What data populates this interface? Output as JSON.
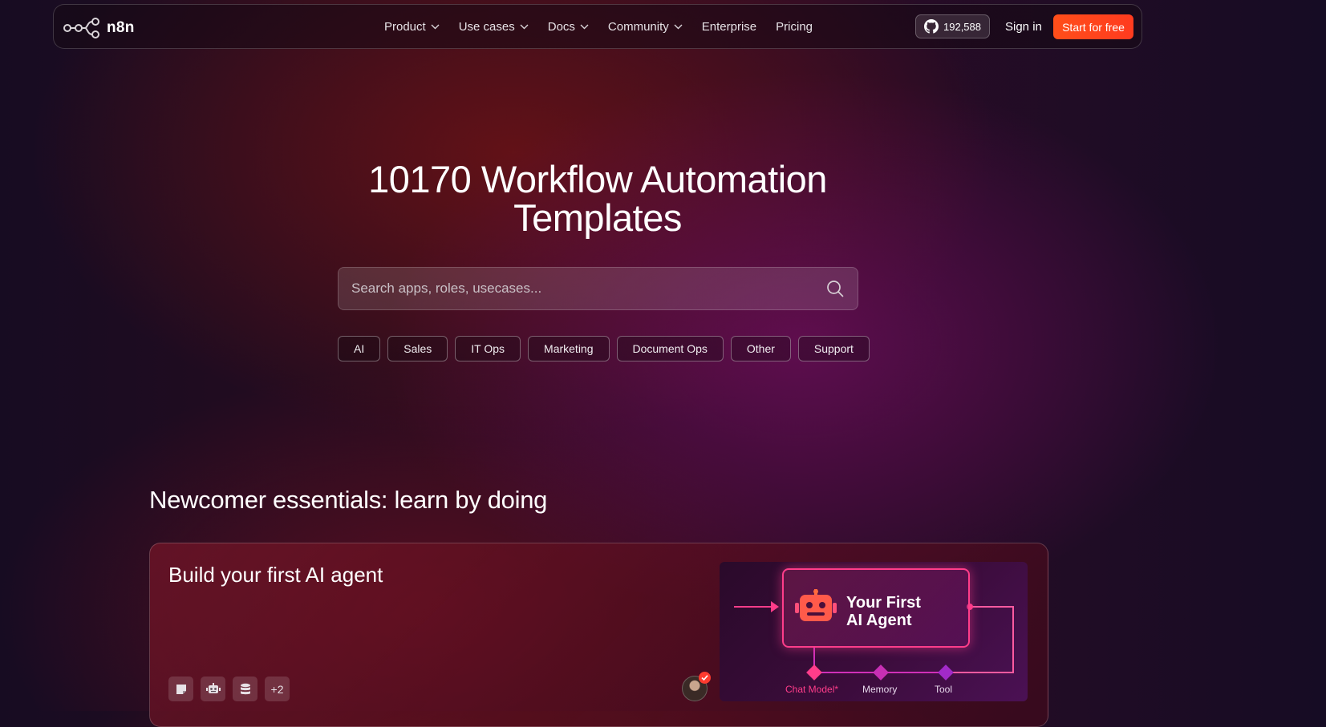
{
  "nav": {
    "brand": "n8n",
    "links": [
      {
        "label": "Product",
        "dropdown": true
      },
      {
        "label": "Use cases",
        "dropdown": true
      },
      {
        "label": "Docs",
        "dropdown": true
      },
      {
        "label": "Community",
        "dropdown": true
      },
      {
        "label": "Enterprise",
        "dropdown": false
      },
      {
        "label": "Pricing",
        "dropdown": false
      }
    ],
    "github_stars": "192,588",
    "signin": "Sign in",
    "cta": "Start for free"
  },
  "hero": {
    "title_line1": "10170 Workflow Automation",
    "title_line2": "Templates",
    "search_placeholder": "Search apps, roles, usecases...",
    "categories": [
      "AI",
      "Sales",
      "IT Ops",
      "Marketing",
      "Document Ops",
      "Other",
      "Support"
    ]
  },
  "section": {
    "title": "Newcomer essentials: learn by doing",
    "card": {
      "title": "Build your first AI agent",
      "icons": [
        "note-icon",
        "robot-icon",
        "database-icon"
      ],
      "more_count": "+2",
      "preview": {
        "title_line1": "Your First",
        "title_line2": "AI Agent",
        "labels": [
          "Chat Model*",
          "Memory",
          "Tool"
        ]
      }
    }
  },
  "colors": {
    "accent": "#ff4e1a",
    "preview_pink": "#ff3d8a",
    "preview_purple": "#b12fd0"
  }
}
